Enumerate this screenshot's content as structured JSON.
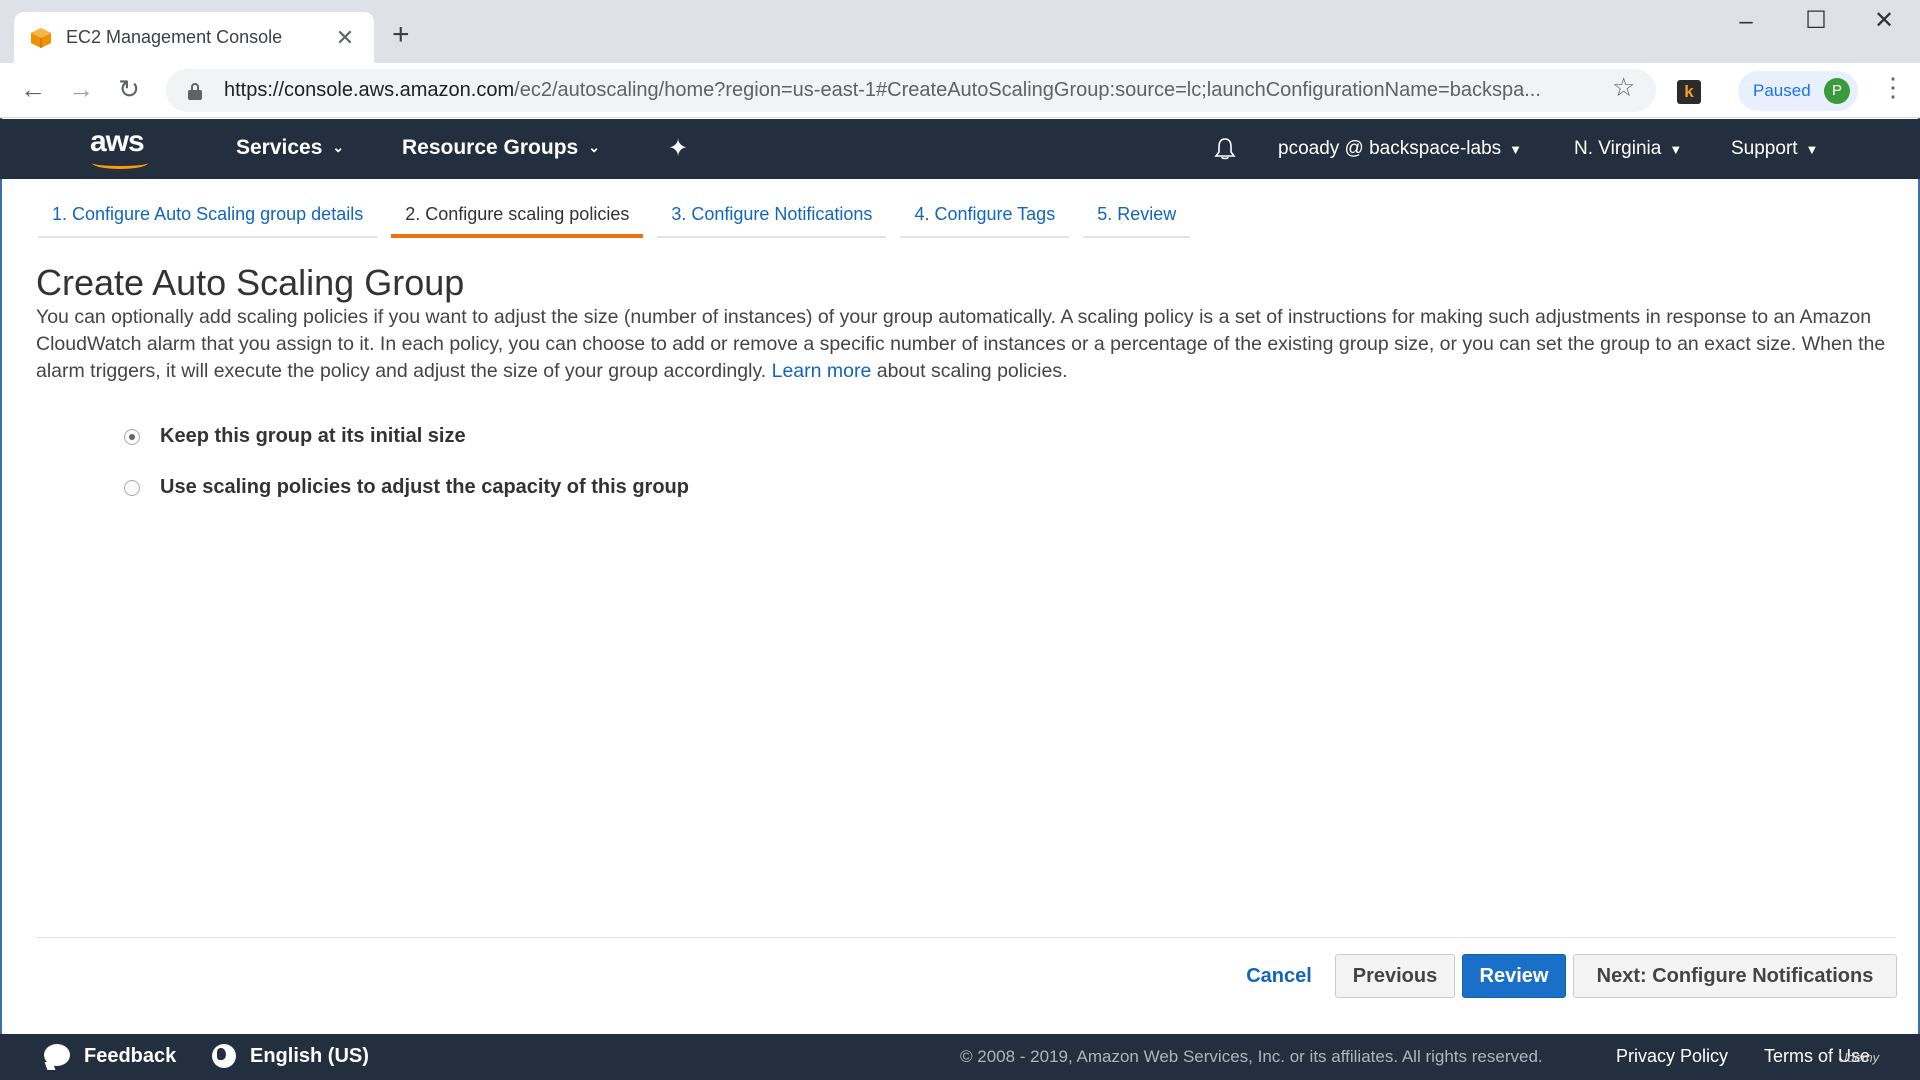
{
  "browser": {
    "tab_title": "EC2 Management Console",
    "url_host": "https://console.aws.amazon.com",
    "url_rest": "/ec2/autoscaling/home?region=us-east-1#CreateAutoScalingGroup:source=lc;launchConfigurationName=backspa...",
    "paused_label": "Paused",
    "profile_initial": "P",
    "extension_letter": "k"
  },
  "aws_nav": {
    "logo_text": "aws",
    "services": "Services",
    "resource_groups": "Resource Groups",
    "account": "pcoady @ backspace-labs",
    "region": "N. Virginia",
    "support": "Support"
  },
  "steps": [
    {
      "label": "1. Configure Auto Scaling group details",
      "active": false
    },
    {
      "label": "2. Configure scaling policies",
      "active": true
    },
    {
      "label": "3. Configure Notifications",
      "active": false
    },
    {
      "label": "4. Configure Tags",
      "active": false
    },
    {
      "label": "5. Review",
      "active": false
    }
  ],
  "page": {
    "title": "Create Auto Scaling Group",
    "description_before_link": "You can optionally add scaling policies if you want to adjust the size (number of instances) of your group automatically. A scaling policy is a set of instructions for making such adjustments in response to an Amazon CloudWatch alarm that you assign to it. In each policy, you can choose to add or remove a specific number of instances or a percentage of the existing group size, or you can set the group to an exact size. When the alarm triggers, it will execute the policy and adjust the size of your group accordingly.",
    "learn_more": "Learn more",
    "description_after_link": "about scaling policies."
  },
  "options": [
    {
      "label": "Keep this group at its initial size",
      "checked": true
    },
    {
      "label": "Use scaling policies to adjust the capacity of this group",
      "checked": false
    }
  ],
  "actions": {
    "cancel": "Cancel",
    "previous": "Previous",
    "review": "Review",
    "next": "Next: Configure Notifications"
  },
  "footer": {
    "feedback": "Feedback",
    "language": "English (US)",
    "copyright": "© 2008 - 2019, Amazon Web Services, Inc. or its affiliates. All rights reserved.",
    "privacy": "Privacy Policy",
    "terms": "Terms of Use",
    "watermark": "Udemy"
  },
  "colors": {
    "aws_nav_bg": "#232f3e",
    "aws_orange": "#ff9900",
    "link_blue": "#1166bb",
    "primary_button": "#1a70c8",
    "active_step_underline": "#ec7211"
  }
}
